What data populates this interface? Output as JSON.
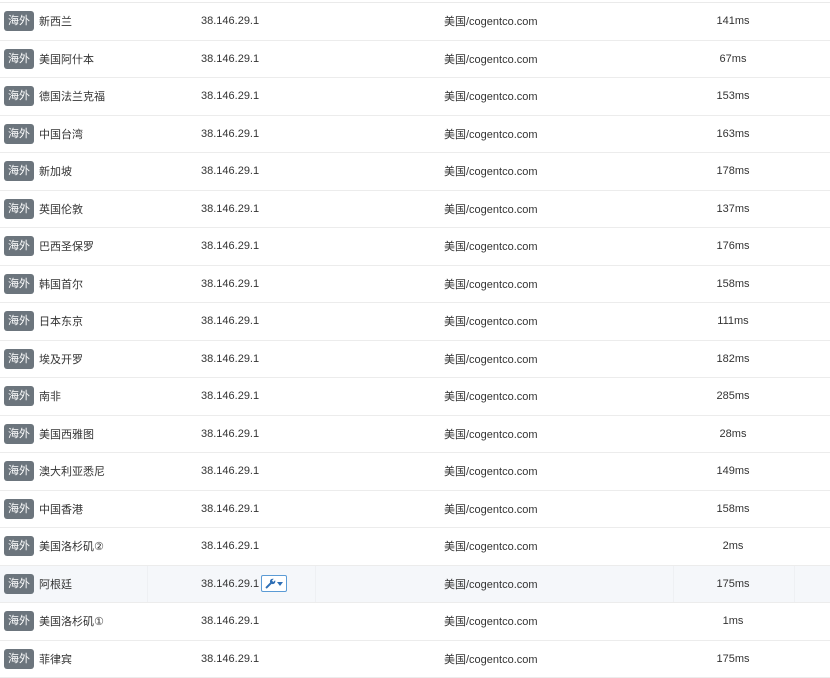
{
  "rows": [
    {
      "tag": "海外",
      "node": "新西兰",
      "ip": "38.146.29.1",
      "isp": "美国/cogentco.com",
      "time": "141ms"
    },
    {
      "tag": "海外",
      "node": "美国阿什本",
      "ip": "38.146.29.1",
      "isp": "美国/cogentco.com",
      "time": "67ms"
    },
    {
      "tag": "海外",
      "node": "德国法兰克福",
      "ip": "38.146.29.1",
      "isp": "美国/cogentco.com",
      "time": "153ms"
    },
    {
      "tag": "海外",
      "node": "中国台湾",
      "ip": "38.146.29.1",
      "isp": "美国/cogentco.com",
      "time": "163ms"
    },
    {
      "tag": "海外",
      "node": "新加坡",
      "ip": "38.146.29.1",
      "isp": "美国/cogentco.com",
      "time": "178ms"
    },
    {
      "tag": "海外",
      "node": "英国伦敦",
      "ip": "38.146.29.1",
      "isp": "美国/cogentco.com",
      "time": "137ms"
    },
    {
      "tag": "海外",
      "node": "巴西圣保罗",
      "ip": "38.146.29.1",
      "isp": "美国/cogentco.com",
      "time": "176ms"
    },
    {
      "tag": "海外",
      "node": "韩国首尔",
      "ip": "38.146.29.1",
      "isp": "美国/cogentco.com",
      "time": "158ms"
    },
    {
      "tag": "海外",
      "node": "日本东京",
      "ip": "38.146.29.1",
      "isp": "美国/cogentco.com",
      "time": "111ms"
    },
    {
      "tag": "海外",
      "node": "埃及开罗",
      "ip": "38.146.29.1",
      "isp": "美国/cogentco.com",
      "time": "182ms"
    },
    {
      "tag": "海外",
      "node": "南非",
      "ip": "38.146.29.1",
      "isp": "美国/cogentco.com",
      "time": "285ms"
    },
    {
      "tag": "海外",
      "node": "美国西雅图",
      "ip": "38.146.29.1",
      "isp": "美国/cogentco.com",
      "time": "28ms"
    },
    {
      "tag": "海外",
      "node": "澳大利亚悉尼",
      "ip": "38.146.29.1",
      "isp": "美国/cogentco.com",
      "time": "149ms"
    },
    {
      "tag": "海外",
      "node": "中国香港",
      "ip": "38.146.29.1",
      "isp": "美国/cogentco.com",
      "time": "158ms"
    },
    {
      "tag": "海外",
      "node": "美国洛杉矶②",
      "ip": "38.146.29.1",
      "isp": "美国/cogentco.com",
      "time": "2ms"
    },
    {
      "tag": "海外",
      "node": "阿根廷",
      "ip": "38.146.29.1",
      "isp": "美国/cogentco.com",
      "time": "175ms",
      "hover": true,
      "tool_icon": "wrench-icon"
    },
    {
      "tag": "海外",
      "node": "美国洛杉矶①",
      "ip": "38.146.29.1",
      "isp": "美国/cogentco.com",
      "time": "1ms"
    },
    {
      "tag": "海外",
      "node": "菲律宾",
      "ip": "38.146.29.1",
      "isp": "美国/cogentco.com",
      "time": "175ms"
    }
  ],
  "colors": {
    "tag_bg": "#6c757d",
    "tool_border": "#5b9bd5",
    "tool_icon": "#2f6fb5",
    "hover_bg": "#f5f7fa"
  }
}
